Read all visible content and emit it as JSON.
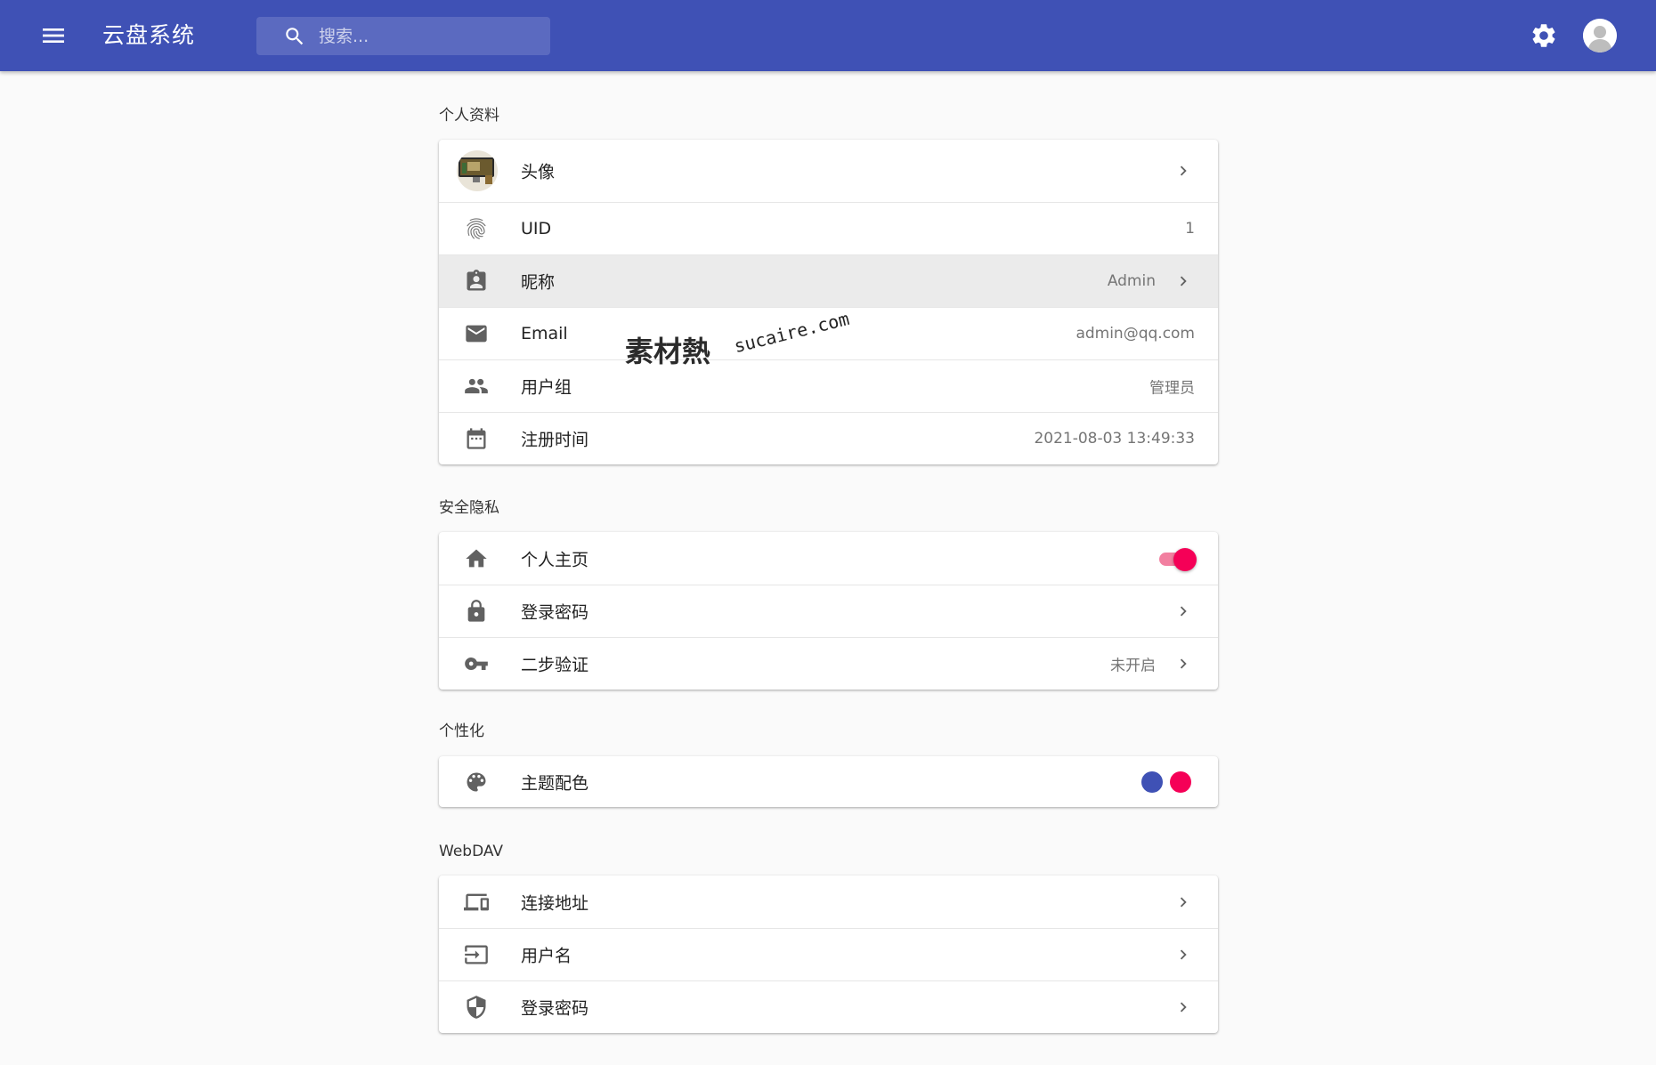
{
  "app": {
    "title": "云盘系统",
    "search_placeholder": "搜索...",
    "accent_color": "#3f51b5",
    "secondary_color": "#f50057"
  },
  "sections": {
    "profile": {
      "title": "个人资料",
      "avatar_label": "头像",
      "uid_label": "UID",
      "uid_value": "1",
      "nickname_label": "昵称",
      "nickname_value": "Admin",
      "email_label": "Email",
      "email_value": "admin@qq.com",
      "group_label": "用户组",
      "group_value": "管理员",
      "register_label": "注册时间",
      "register_value": "2021-08-03 13:49:33"
    },
    "security": {
      "title": "安全隐私",
      "homepage_label": "个人主页",
      "homepage_enabled": true,
      "password_label": "登录密码",
      "twofa_label": "二步验证",
      "twofa_value": "未开启"
    },
    "personalization": {
      "title": "个性化",
      "theme_label": "主题配色",
      "theme_colors": [
        "#3f51b5",
        "#f50057"
      ]
    },
    "webdav": {
      "title": "WebDAV",
      "address_label": "连接地址",
      "username_label": "用户名",
      "password_label": "登录密码"
    }
  },
  "watermark": {
    "text": "素材熱",
    "url": "sucaire.com"
  }
}
